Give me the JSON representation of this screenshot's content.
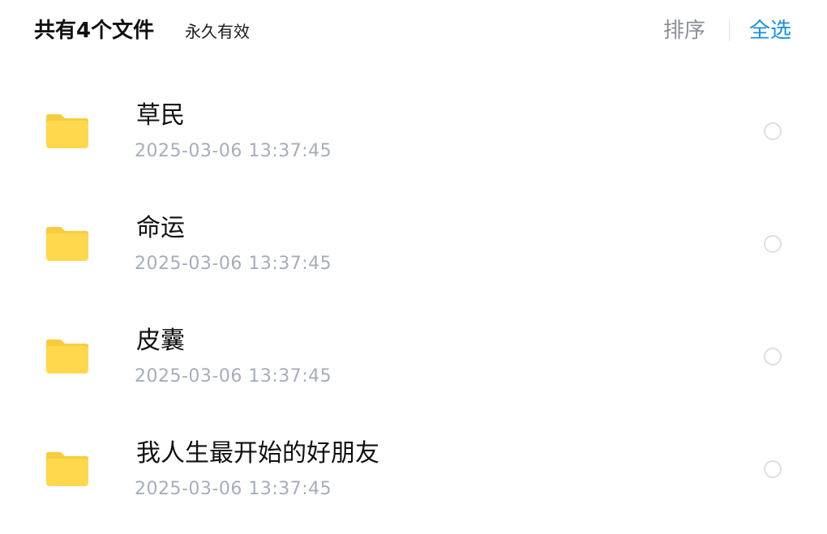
{
  "header": {
    "file_count": "共有4个文件",
    "validity": "永久有效",
    "sort_label": "排序",
    "select_all_label": "全选"
  },
  "colors": {
    "accent": "#1a8fe3",
    "folder": "#ffd84d",
    "folder_tab": "#f8cc3c",
    "muted_text": "#a7adba"
  },
  "files": [
    {
      "name": "草民",
      "time": "2025-03-06   13:37:45",
      "icon": "folder-icon"
    },
    {
      "name": "命运",
      "time": "2025-03-06   13:37:45",
      "icon": "folder-icon"
    },
    {
      "name": "皮囊",
      "time": "2025-03-06   13:37:45",
      "icon": "folder-icon"
    },
    {
      "name": "我人生最开始的好朋友",
      "time": "2025-03-06   13:37:45",
      "icon": "folder-icon"
    }
  ]
}
